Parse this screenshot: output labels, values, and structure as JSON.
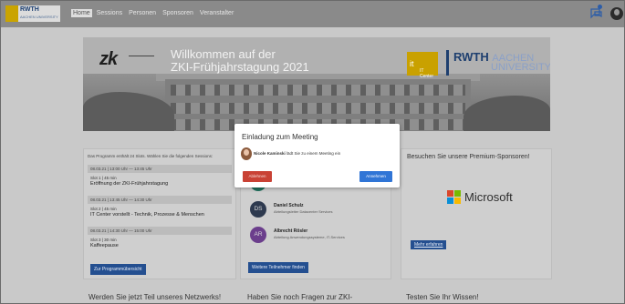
{
  "nav": {
    "logo_text": "RWTH",
    "logo_sub": "AACHEN UNIVERSITY",
    "links": [
      "Home",
      "Sessions",
      "Personen",
      "Sponsoren",
      "Veranstalter"
    ]
  },
  "banner": {
    "logo_text": "zk",
    "welcome_line1": "Willkommen auf der",
    "welcome_line2": "ZKI-Frühjahrstagung 2021",
    "itc_symbol": "it",
    "itc_label": "IT Center",
    "rwth_text": "RWTH",
    "rwth_aachen": "AACHEN",
    "rwth_university": "UNIVERSITY"
  },
  "program": {
    "note": "Das Programm enthält 24 Slots. Wählen Sie die folgenden Sessions:",
    "sessions": [
      {
        "time": "08.03.21 | 13:00 Uhr — 13:45 Uhr",
        "meta": "Slot 1 | 45 min",
        "title": "Eröffnung der ZKI-Frühjahrstagung"
      },
      {
        "time": "08.03.21 | 13:45 Uhr — 14:30 Uhr",
        "meta": "Slot 2 | 45 min",
        "title": "IT Center vorstellt - Technik, Prozesse & Menschen"
      },
      {
        "time": "08.03.21 | 14:30 Uhr — 15:00 Uhr",
        "meta": "Slot 3 | 30 min",
        "title": "Kaffeepause"
      }
    ],
    "button": "Zur Programmübersicht"
  },
  "contacts": {
    "people": [
      {
        "initials": "DS",
        "name": "Daniel Schulz",
        "role": "Abteilungsleiter Datacenter Services",
        "color": "#2e3a4f"
      },
      {
        "initials": "AR",
        "name": "Albrecht Rösler",
        "role": "Abteilung Anwendungssysteme, IT-Services",
        "color": "#6b3e8c"
      }
    ],
    "button": "Weitere Teilnehmer finden"
  },
  "sponsors": {
    "heading": "Besuchen Sie unsere Premium-Sponsoren!",
    "sponsor_name": "Microsoft",
    "button": "Mehr erfahren"
  },
  "bottom": {
    "left": "Werden Sie jetzt Teil unseres Netzwerks!",
    "middle": "Haben Sie noch Fragen zur ZKI-",
    "right": "Testen Sie Ihr Wissen!"
  },
  "modal": {
    "title": "Einladung zum Meeting",
    "caller": "Nicole Kaminski",
    "message": "lädt Sie zu einem Meeting ein",
    "decline": "Ablehnen",
    "accept": "Annehmen"
  },
  "colors": {
    "accent_blue": "#244f90",
    "decline_red": "#c94235",
    "accept_blue": "#3075d6"
  }
}
